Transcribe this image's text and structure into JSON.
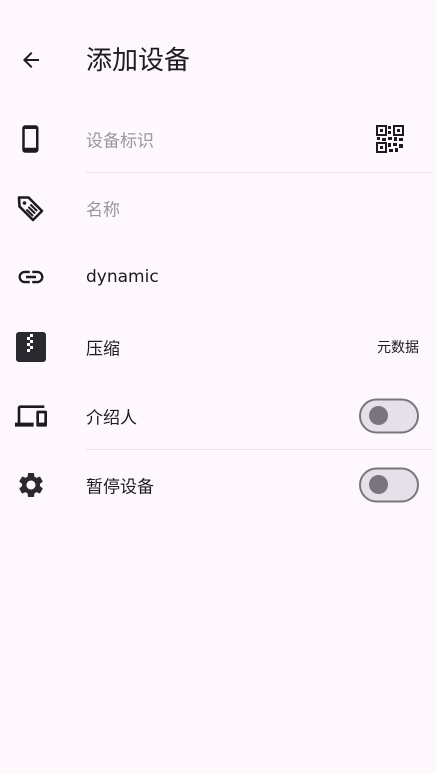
{
  "header": {
    "title": "添加设备",
    "back_icon": "arrow-back-icon"
  },
  "fields": {
    "device_id": {
      "placeholder": "设备标识",
      "icon": "smartphone-icon",
      "trailing_icon": "qr-code-icon"
    },
    "name": {
      "placeholder": "名称",
      "icon": "label-tag-icon"
    },
    "address": {
      "value": "dynamic",
      "icon": "link-icon"
    },
    "compression": {
      "label": "压缩",
      "value": "元数据",
      "icon": "zip-archive-icon"
    },
    "introducer": {
      "label": "介绍人",
      "icon": "devices-icon",
      "enabled": false
    },
    "paused": {
      "label": "暂停设备",
      "icon": "settings-gear-icon",
      "enabled": false
    }
  },
  "colors": {
    "background": "#fef7fc",
    "text": "#1d1b20",
    "placeholder": "#9a979e",
    "divider": "#e7e0ec",
    "switch_track": "#e6e0e9",
    "switch_outline": "#79747e",
    "icon": "#49454f"
  }
}
